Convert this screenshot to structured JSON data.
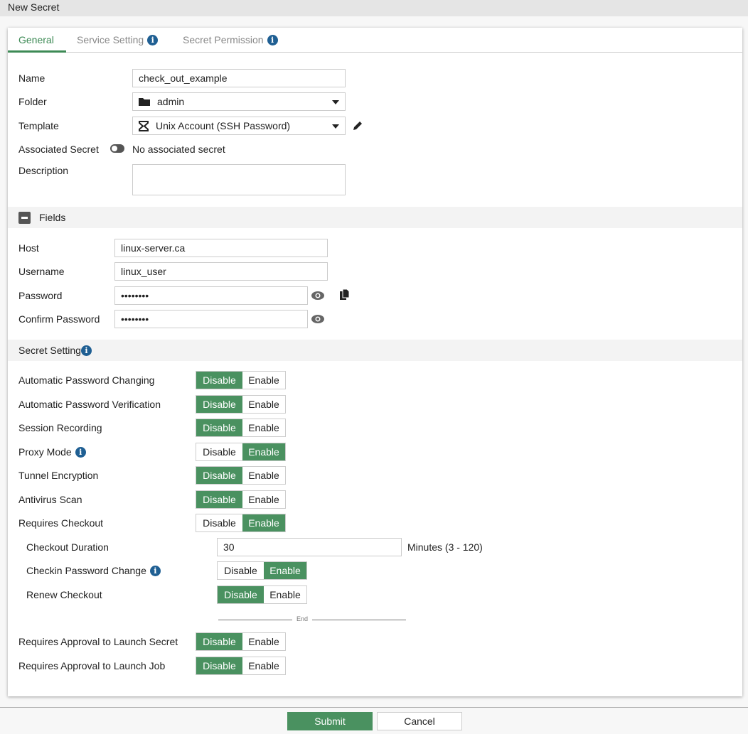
{
  "window_title": "New Secret",
  "tabs": [
    {
      "label": "General",
      "active": true
    },
    {
      "label": "Service Setting",
      "info": true
    },
    {
      "label": "Secret Permission",
      "info": true
    }
  ],
  "general": {
    "name": {
      "label": "Name",
      "value": "check_out_example"
    },
    "folder": {
      "label": "Folder",
      "value": "admin"
    },
    "template": {
      "label": "Template",
      "value": "Unix Account (SSH Password)"
    },
    "associated": {
      "label": "Associated Secret",
      "value": "No associated secret"
    },
    "description": {
      "label": "Description",
      "value": ""
    }
  },
  "fields": {
    "title": "Fields",
    "host": {
      "label": "Host",
      "value": "linux-server.ca"
    },
    "username": {
      "label": "Username",
      "value": "linux_user"
    },
    "password": {
      "label": "Password",
      "value": "••••••••"
    },
    "confirm": {
      "label": "Confirm Password",
      "value": "••••••••"
    }
  },
  "secret_setting": {
    "title": "Secret Setting",
    "disable": "Disable",
    "enable": "Enable",
    "rows": [
      {
        "label": "Automatic Password Changing",
        "value": "Disable"
      },
      {
        "label": "Automatic Password Verification",
        "value": "Disable"
      },
      {
        "label": "Session Recording",
        "value": "Disable"
      },
      {
        "label": "Proxy Mode",
        "value": "Enable",
        "info": true
      },
      {
        "label": "Tunnel Encryption",
        "value": "Disable"
      },
      {
        "label": "Antivirus Scan",
        "value": "Disable"
      },
      {
        "label": "Requires Checkout",
        "value": "Enable"
      }
    ],
    "checkout_duration": {
      "label": "Checkout Duration",
      "value": "30",
      "suffix": "Minutes (3 - 120)"
    },
    "sub_rows": [
      {
        "label": "Checkin Password Change",
        "value": "Enable",
        "info": true
      },
      {
        "label": "Renew Checkout",
        "value": "Disable"
      }
    ],
    "end_label": "End",
    "approval_rows": [
      {
        "label": "Requires Approval to Launch Secret",
        "value": "Disable"
      },
      {
        "label": "Requires Approval to Launch Job",
        "value": "Disable"
      }
    ]
  },
  "footer": {
    "submit": "Submit",
    "cancel": "Cancel"
  },
  "colors": {
    "accent": "#4a9160",
    "info": "#1f5f93"
  }
}
